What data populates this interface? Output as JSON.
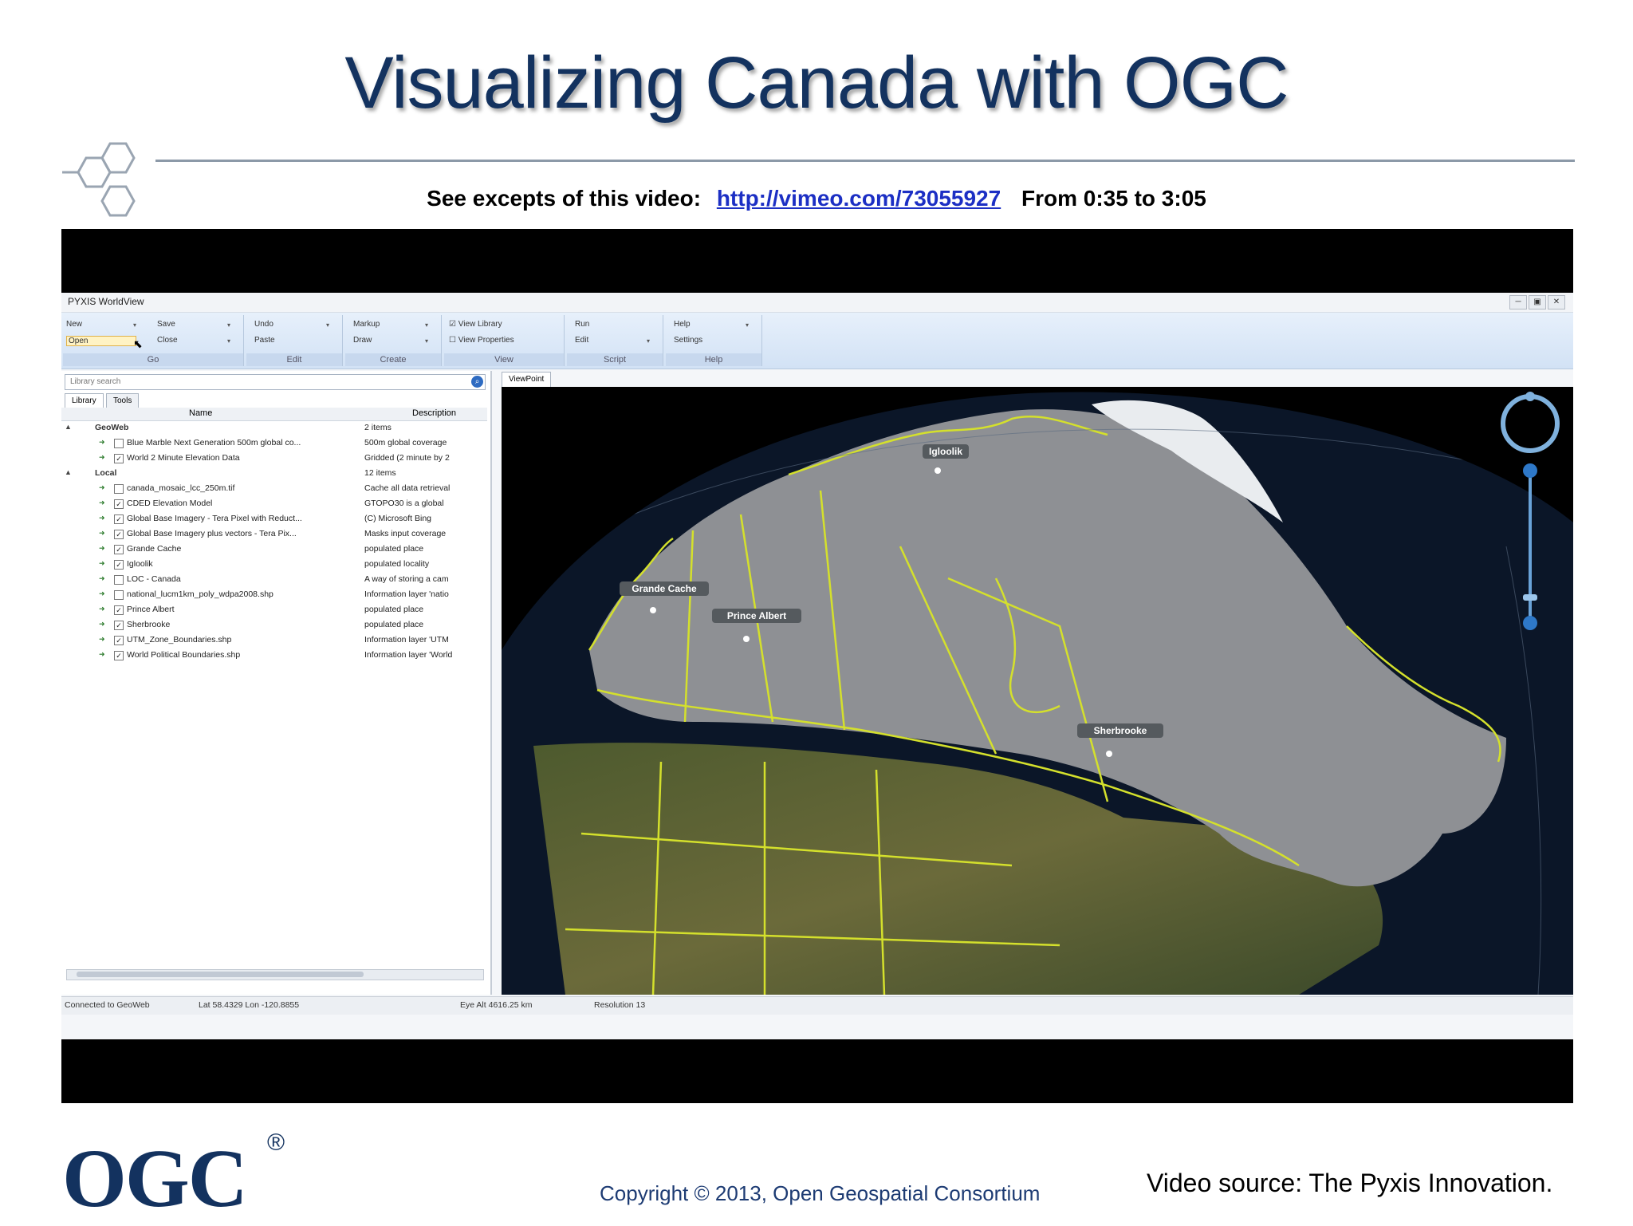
{
  "slide": {
    "title": "Visualizing Canada with OGC",
    "excerpt_label": "See excepts of this video:",
    "excerpt_link": "http://vimeo.com/73055927",
    "excerpt_range": "From 0:35 to 3:05",
    "copyright": "Copyright © 2013, Open Geospatial Consortium",
    "video_source": "Video source: The Pyxis Innovation.",
    "logo_text": "OGC",
    "logo_reg": "®"
  },
  "app": {
    "title": "PYXIS WorldView",
    "ribbon": {
      "groups": [
        {
          "label": "Go",
          "items": [
            "New",
            "Open",
            "Save",
            "Close"
          ]
        },
        {
          "label": "Edit",
          "items": [
            "Undo",
            "Paste"
          ]
        },
        {
          "label": "Create",
          "items": [
            "Markup",
            "Draw"
          ]
        },
        {
          "label": "View",
          "items": [
            "View Library",
            "View Properties"
          ]
        },
        {
          "label": "Script",
          "items": [
            "Run",
            "Edit"
          ]
        },
        {
          "label": "Help",
          "items": [
            "Help",
            "Settings"
          ]
        }
      ]
    },
    "library": {
      "search_placeholder": "Library search",
      "tabs": [
        "Library",
        "Tools"
      ],
      "columns": [
        "Name",
        "Description"
      ],
      "groups": [
        {
          "name": "GeoWeb",
          "description": "2 items",
          "items": [
            {
              "name": "Blue Marble Next Generation 500m global co...",
              "description": "500m global coverage",
              "checked": false
            },
            {
              "name": "World 2 Minute Elevation Data",
              "description": "Gridded (2 minute by 2",
              "checked": true
            }
          ]
        },
        {
          "name": "Local",
          "description": "12 items",
          "items": [
            {
              "name": "canada_mosaic_lcc_250m.tif",
              "description": "Cache all data retrieval",
              "checked": false
            },
            {
              "name": "CDED Elevation Model",
              "description": "GTOPO30 is a global",
              "checked": true
            },
            {
              "name": "Global Base Imagery - Tera Pixel with Reduct...",
              "description": "(C) Microsoft Bing",
              "checked": true
            },
            {
              "name": "Global Base Imagery plus vectors - Tera Pix...",
              "description": "Masks input coverage",
              "checked": true
            },
            {
              "name": "Grande Cache",
              "description": "populated place",
              "checked": true
            },
            {
              "name": "Igloolik",
              "description": "populated locality",
              "checked": true
            },
            {
              "name": "LOC - Canada",
              "description": "A way of storing a cam",
              "checked": false
            },
            {
              "name": "national_lucm1km_poly_wdpa2008.shp",
              "description": "Information layer 'natio",
              "checked": false
            },
            {
              "name": "Prince Albert",
              "description": "populated place",
              "checked": true
            },
            {
              "name": "Sherbrooke",
              "description": "populated place",
              "checked": true
            },
            {
              "name": "UTM_Zone_Boundaries.shp",
              "description": "Information layer 'UTM",
              "checked": true
            },
            {
              "name": "World Political Boundaries.shp",
              "description": "Information layer 'World",
              "checked": true
            }
          ]
        }
      ]
    },
    "view_tab": "ViewPoint",
    "places": [
      "Grande Cache",
      "Prince Albert",
      "Igloolik",
      "Sherbrooke"
    ],
    "status": {
      "connection": "Connected to GeoWeb",
      "latlon": "Lat 58.4329 Lon -120.8855",
      "eye": "Eye Alt 4616.25 km",
      "resolution": "Resolution 13"
    },
    "colors": {
      "boundary": "#d4e02c",
      "canada_overlay": "#8e9094",
      "ocean": "#0a1220",
      "sky": "#000000"
    }
  }
}
